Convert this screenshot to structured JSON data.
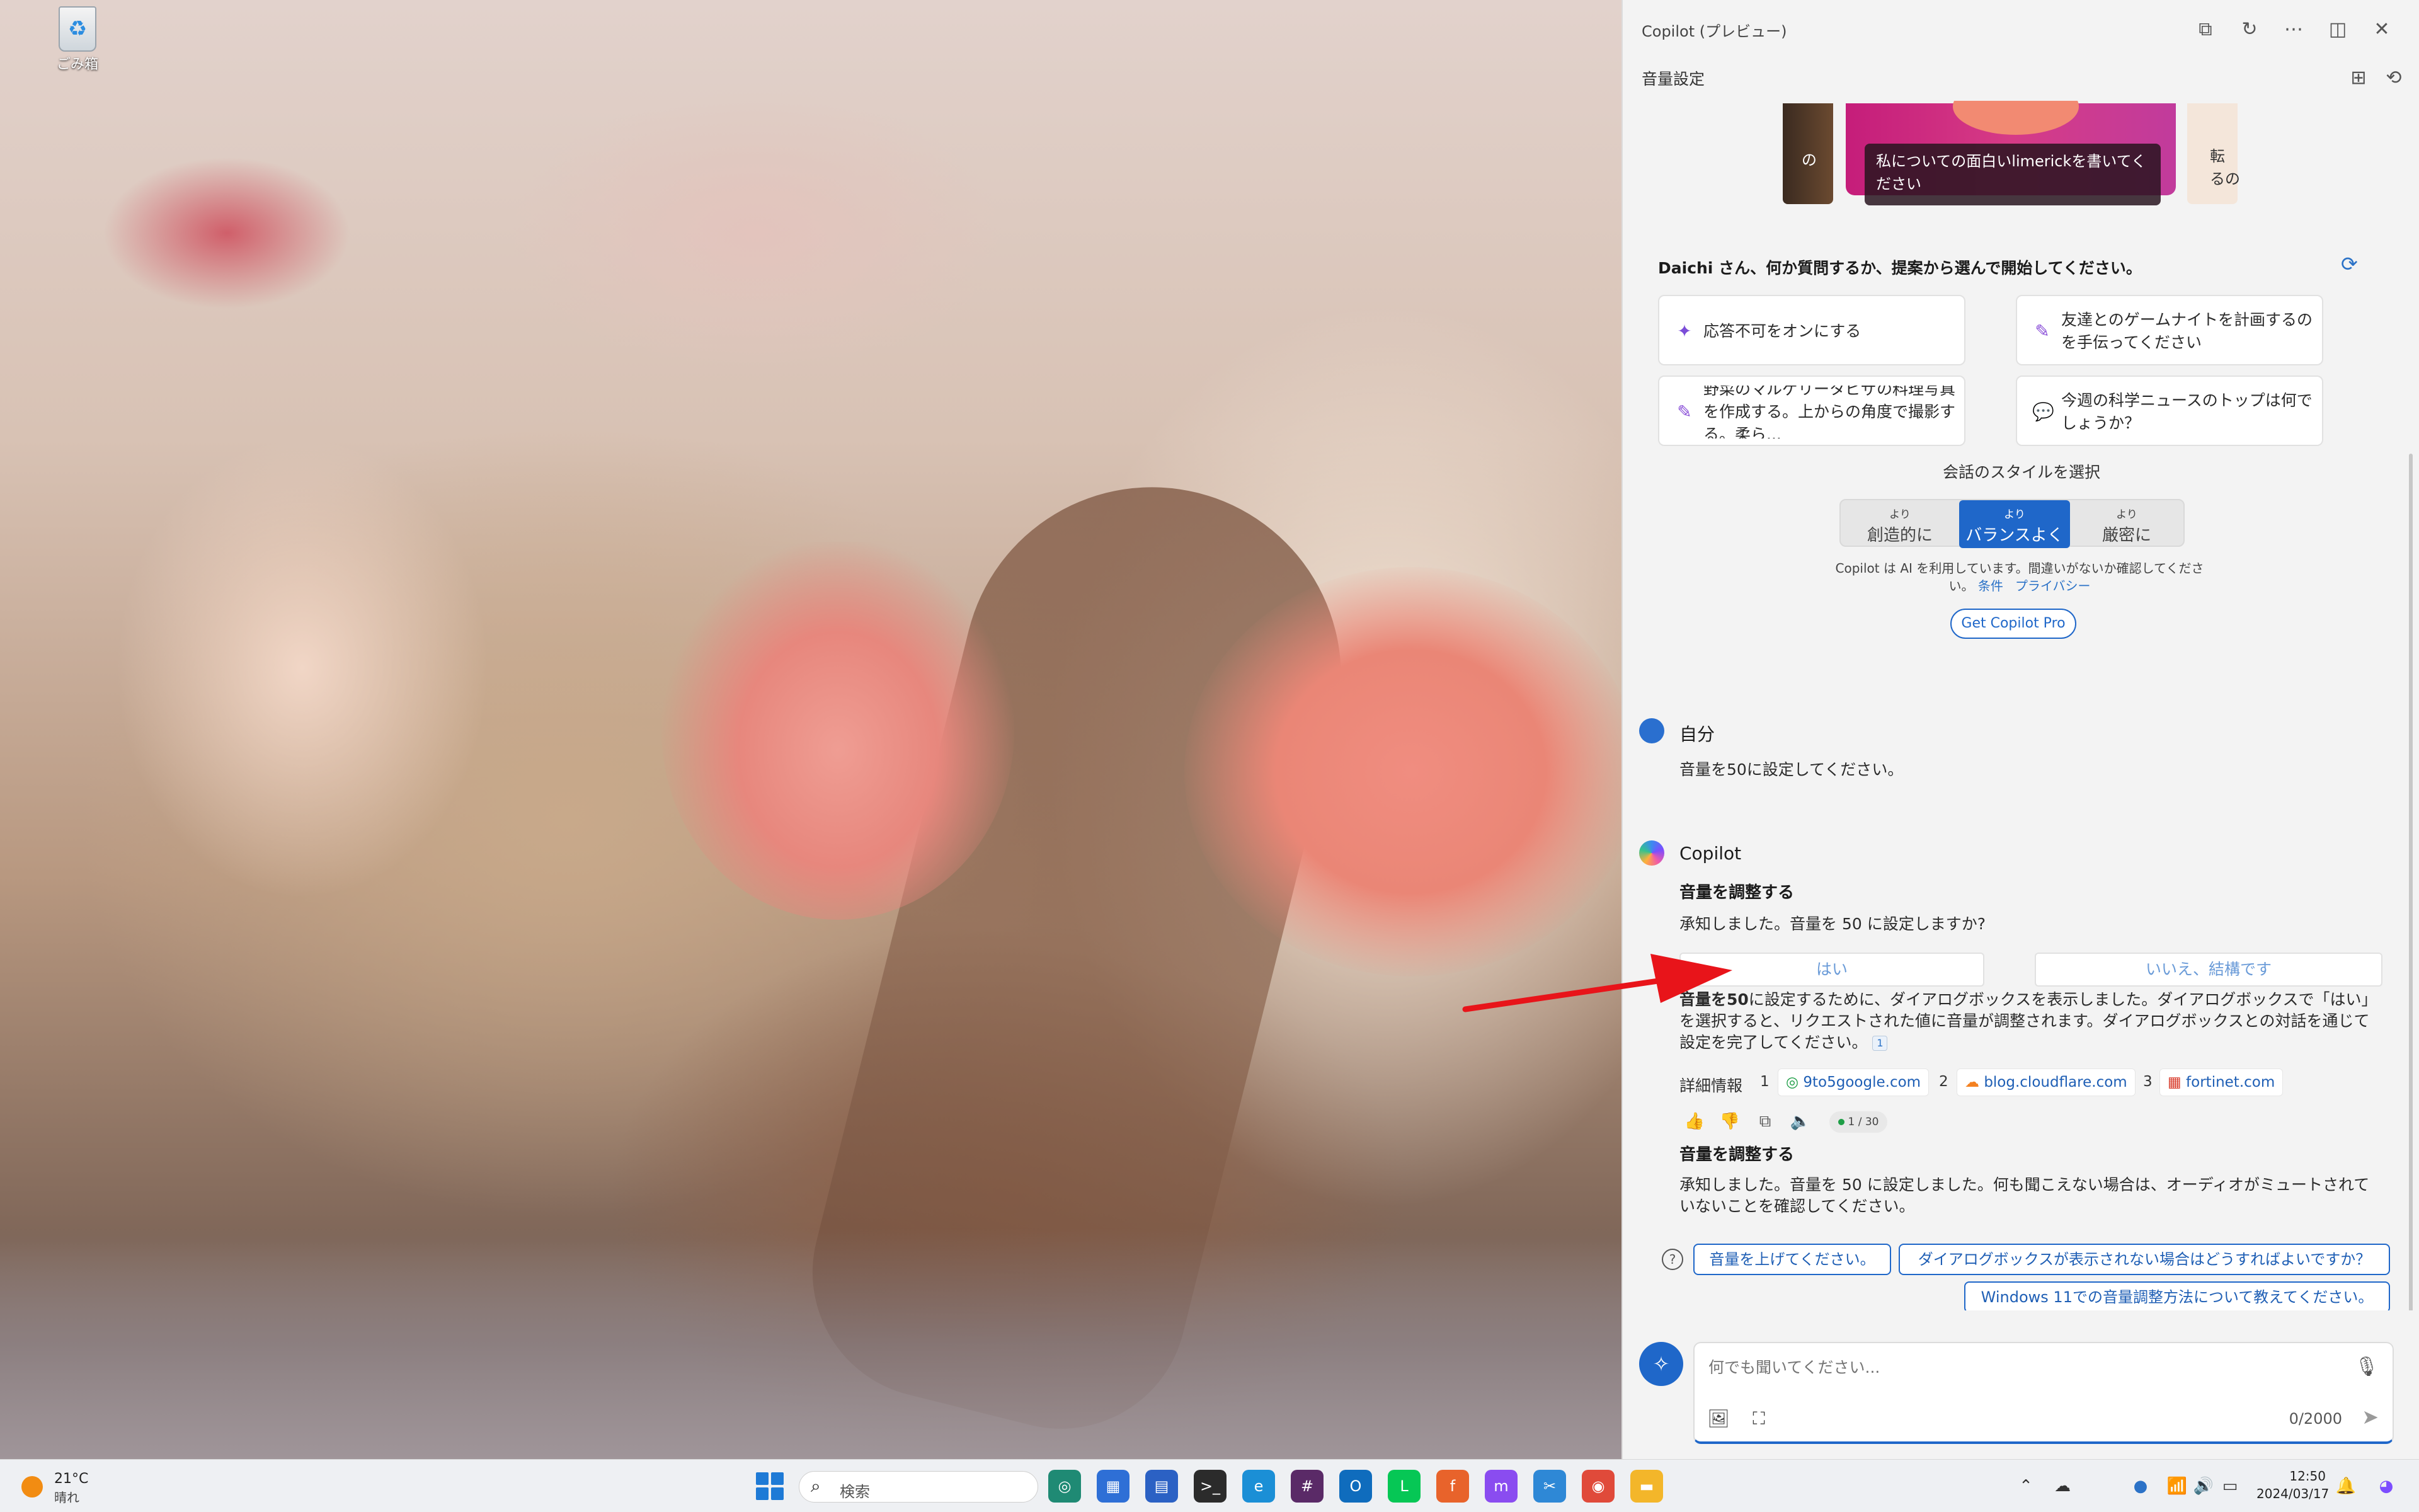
{
  "desktop": {
    "recycle_bin_label": "ごみ箱"
  },
  "copilot": {
    "window_title": "Copilot (プレビュー)",
    "header_buttons": [
      "open-external",
      "refresh",
      "more",
      "split-view",
      "close"
    ],
    "subheader": "音量設定",
    "carousel": {
      "left_card_text": "の",
      "main_card_caption": "私についての面白いlimerickを書いてください",
      "right_card_text": "転\nるの"
    },
    "greeting": "Daichi さん、何か質問するか、提案から選んで開始してください。",
    "suggestions": [
      {
        "icon": "sparkle-icon",
        "color": "#7b4dd8",
        "text": "応答不可をオンにする"
      },
      {
        "icon": "notebook-icon",
        "color": "#8a4fd8",
        "text": "友達とのゲームナイトを計画するのを手伝ってください"
      },
      {
        "icon": "image-edit-icon",
        "color": "#8a4fd8",
        "text": "野菜のマルゲリータピザの料理写真を作成する。上からの角度で撮影する。柔ら..."
      },
      {
        "icon": "chat-bubbles-icon",
        "color": "#3b63d8",
        "text": "今週の科学ニュースのトップは何でしょうか？"
      }
    ],
    "style_selector": {
      "label": "会話のスタイルを選択",
      "options": [
        {
          "small": "より",
          "large": "創造的に",
          "active": false
        },
        {
          "small": "より",
          "large": "バランスよく",
          "active": true
        },
        {
          "small": "より",
          "large": "厳密に",
          "active": false
        }
      ]
    },
    "disclaimer": {
      "text": "Copilot は AI を利用しています。間違いがないか確認してください。",
      "terms_link": "条件",
      "privacy_link": "プライバシー"
    },
    "get_pro_button": "Get Copilot Pro",
    "user_message": {
      "name": "自分",
      "text": "音量を50に設定してください。"
    },
    "response": {
      "name": "Copilot",
      "heading1": "音量を調整する",
      "text1": "承知しました。音量を 50 に設定しますか?",
      "yes_button": "はい",
      "no_button": "いいえ、結構です",
      "explain_bold": "音量を50",
      "explain_rest": "に設定するために、ダイアログボックスを表示しました。ダイアログボックスで「はい」を選択すると、リクエストされた値に音量が調整されます。ダイアログボックスとの対話を通じて設定を完了してください。",
      "citation": "1",
      "more_info_label": "詳細情報",
      "sources": [
        {
          "num": "1",
          "icon": "shield-icon",
          "label": "9to5google.com"
        },
        {
          "num": "2",
          "icon": "cloud-icon",
          "label": "blog.cloudflare.com"
        },
        {
          "num": "3",
          "icon": "grid-icon",
          "label": "fortinet.com"
        }
      ],
      "counter": "1 / 30",
      "heading2": "音量を調整する",
      "text2": "承知しました。音量を 50 に設定しました。何も聞こえない場合は、オーディオがミュートされていないことを確認してください。"
    },
    "followups": [
      "音量を上げてください。",
      "ダイアログボックスが表示されない場合はどうすればよいですか？",
      "Windows 11での音量調整方法について教えてください。"
    ],
    "input": {
      "placeholder": "何でも聞いてください...",
      "char_count": "0/2000"
    }
  },
  "taskbar": {
    "weather_temp": "21°C",
    "weather_condition": "晴れ",
    "search_placeholder": "検索",
    "apps": [
      {
        "name": "copilot-app-icon",
        "color": "#1f8a74",
        "glyph": "◎"
      },
      {
        "name": "calendar-app-icon",
        "color": "#2e6fd6",
        "glyph": "▦"
      },
      {
        "name": "docs-app-icon",
        "color": "#2b61c4",
        "glyph": "▤"
      },
      {
        "name": "terminal-app-icon",
        "color": "#2b2b2b",
        "glyph": ">_"
      },
      {
        "name": "edge-app-icon",
        "color": "#1b8fd6",
        "glyph": "e"
      },
      {
        "name": "slack-app-icon",
        "color": "#5a2a67",
        "glyph": "#"
      },
      {
        "name": "outlook-app-icon",
        "color": "#0f6cbd",
        "glyph": "O"
      },
      {
        "name": "line-app-icon",
        "color": "#06c755",
        "glyph": "L"
      },
      {
        "name": "firefox-app-icon",
        "color": "#e8632b",
        "glyph": "f"
      },
      {
        "name": "messenger-app-icon",
        "color": "#8a4cf0",
        "glyph": "m"
      },
      {
        "name": "snipping-app-icon",
        "color": "#2e88d6",
        "glyph": "✂"
      },
      {
        "name": "chrome-app-icon",
        "color": "#e04a3a",
        "glyph": "◉"
      },
      {
        "name": "explorer-app-icon",
        "color": "#f3b62a",
        "glyph": "▬"
      }
    ],
    "time": "12:50",
    "date": "2024/03/17"
  }
}
